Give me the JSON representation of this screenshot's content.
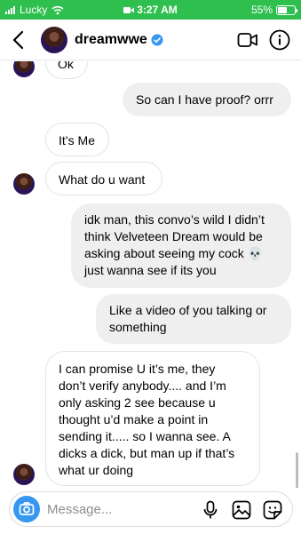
{
  "status_bar": {
    "carrier": "Lucky",
    "time": "3:27 AM",
    "battery_percent": "55%",
    "battery_level": 0.55,
    "signal_icon": "signal-bars-icon",
    "wifi_icon": "wifi-icon",
    "screen_record_icon": "screen-record-icon",
    "charging_icon": "battery-charging-icon"
  },
  "header": {
    "username": "dreamwwe",
    "verified": true,
    "back_icon": "chevron-left-icon",
    "video_icon": "video-call-icon",
    "info_icon": "info-icon"
  },
  "messages": [
    {
      "from": "them",
      "text": "Ok"
    },
    {
      "from": "me",
      "text": "So can I have proof? orrr"
    },
    {
      "from": "them",
      "text": "It’s Me"
    },
    {
      "from": "them",
      "text": "What do u want"
    },
    {
      "from": "me",
      "lines": [
        "idk man, this convo’s wild I didn’t",
        "think Velveteen Dream would be",
        "asking about seeing my cock 💀",
        "just wanna see if its you"
      ]
    },
    {
      "from": "me",
      "lines": [
        "Like a video of you talking or",
        "something"
      ]
    },
    {
      "from": "them",
      "lines": [
        "I can promise U it’s me, they",
        "don’t verify anybody.... and I’m",
        "only asking 2 see because u",
        "thought u’d make a point in",
        "sending it..... so I wanna see. A",
        "dicks a dick, but man up if that’s",
        "what ur doing"
      ]
    }
  ],
  "composer": {
    "placeholder": "Message...",
    "camera_icon": "camera-icon",
    "mic_icon": "microphone-icon",
    "gallery_icon": "gallery-icon",
    "sticker_icon": "sticker-icon"
  },
  "colors": {
    "status_bar": "#2fbf4e",
    "accent": "#3797f0",
    "sent_bubble": "#efefef",
    "received_border": "#e3e3e3"
  }
}
